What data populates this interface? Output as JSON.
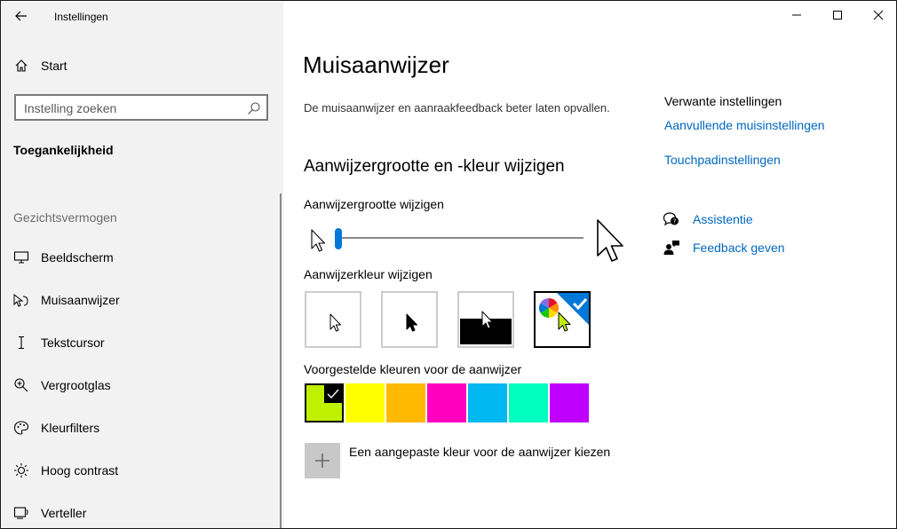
{
  "window": {
    "title": "Instellingen",
    "controls": [
      "minimize-icon",
      "maximize-icon",
      "close-icon"
    ]
  },
  "sidebar": {
    "home_label": "Start",
    "search_placeholder": "Instelling zoeken",
    "section_title": "Toegankelijkheid",
    "group_title": "Gezichtsvermogen",
    "items": [
      {
        "label": "Beeldscherm",
        "icon": "monitor-icon"
      },
      {
        "label": "Muisaanwijzer",
        "icon": "mouse-pointer-icon"
      },
      {
        "label": "Tekstcursor",
        "icon": "text-cursor-icon"
      },
      {
        "label": "Vergrootglas",
        "icon": "magnifier-icon"
      },
      {
        "label": "Kleurfilters",
        "icon": "palette-icon"
      },
      {
        "label": "Hoog contrast",
        "icon": "high-contrast-icon"
      },
      {
        "label": "Verteller",
        "icon": "narrator-icon"
      }
    ]
  },
  "main": {
    "title": "Muisaanwijzer",
    "description": "De muisaanwijzer en aanraakfeedback beter laten opvallen.",
    "section_title": "Aanwijzergrootte en -kleur wijzigen",
    "size_label": "Aanwijzergrootte wijzigen",
    "size_value": 0.0,
    "color_label": "Aanwijzerkleur wijzigen",
    "color_options": [
      {
        "name": "white",
        "selected": false
      },
      {
        "name": "black",
        "selected": false
      },
      {
        "name": "inverted",
        "selected": false
      },
      {
        "name": "custom",
        "selected": true
      }
    ],
    "suggested_label": "Voorgestelde kleuren voor de aanwijzer",
    "suggested_colors": [
      {
        "color": "#bff000",
        "selected": true
      },
      {
        "color": "#ffff00",
        "selected": false
      },
      {
        "color": "#ffb900",
        "selected": false
      },
      {
        "color": "#ff00bf",
        "selected": false
      },
      {
        "color": "#00b7f0",
        "selected": false
      },
      {
        "color": "#00ffc0",
        "selected": false
      },
      {
        "color": "#bf00ff",
        "selected": false
      }
    ],
    "custom_color_label": "Een aangepaste kleur voor de aanwijzer kiezen"
  },
  "related": {
    "title": "Verwante instellingen",
    "links": [
      "Aanvullende muisinstellingen",
      "Touchpadinstellingen"
    ],
    "help": [
      {
        "label": "Assistentie",
        "icon": "help-chat-icon"
      },
      {
        "label": "Feedback geven",
        "icon": "feedback-icon"
      }
    ]
  },
  "colors": {
    "accent": "#0078d7",
    "link": "#0067c0",
    "sidebar_bg": "#f2f2f2"
  }
}
